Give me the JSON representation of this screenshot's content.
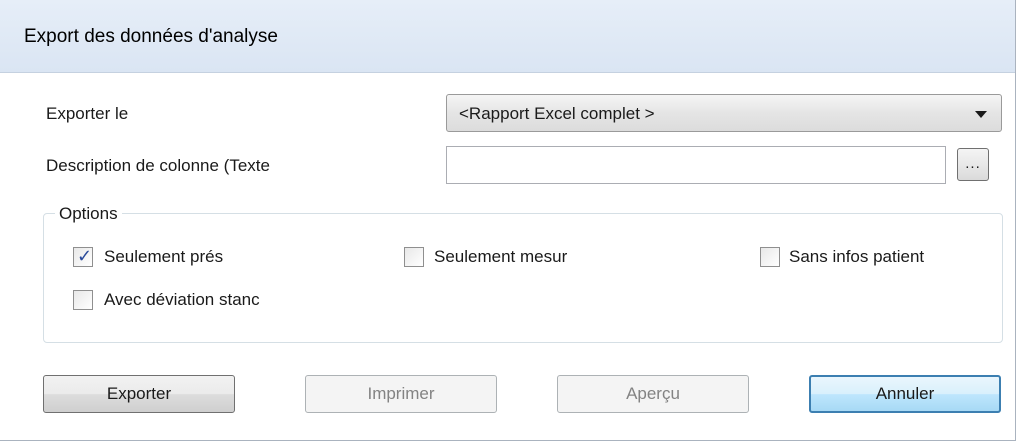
{
  "window": {
    "title": "Export des données d'analyse"
  },
  "form": {
    "export_label": "Exporter le",
    "export_selected": "<Rapport Excel complet >",
    "column_desc_label": "Description de colonne (Texte",
    "column_desc_value": "",
    "browse_label": "..."
  },
  "options": {
    "legend": "Options",
    "only_present": {
      "label": "Seulement prés",
      "checked": true
    },
    "only_measured": {
      "label": "Seulement mesur",
      "checked": false
    },
    "no_patient_info": {
      "label": "Sans infos patient",
      "checked": false
    },
    "with_std_dev": {
      "label": "Avec déviation stanc",
      "checked": false
    }
  },
  "buttons": {
    "export": "Exporter",
    "print": "Imprimer",
    "preview": "Aperçu",
    "cancel": "Annuler"
  }
}
